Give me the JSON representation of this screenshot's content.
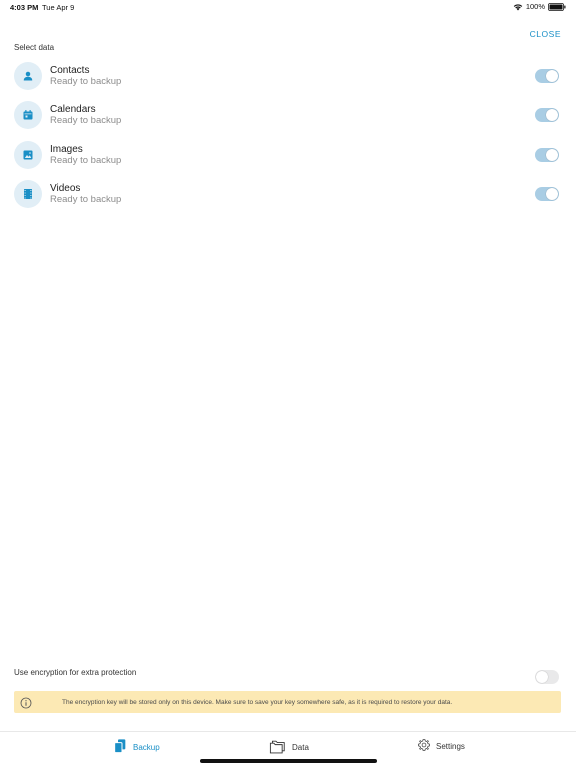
{
  "status_bar": {
    "time": "4:03 PM",
    "date": "Tue Apr 9",
    "battery": "100%",
    "icons": [
      "wifi-icon",
      "battery-icon"
    ]
  },
  "header": {
    "close_label": "CLOSE"
  },
  "select_data": {
    "title": "Select data",
    "items": [
      {
        "label": "Contacts",
        "status": "Ready to backup",
        "icon": "contacts-icon",
        "enabled": true
      },
      {
        "label": "Calendars",
        "status": "Ready to backup",
        "icon": "calendar-icon",
        "enabled": true
      },
      {
        "label": "Images",
        "status": "Ready to backup",
        "icon": "image-icon",
        "enabled": true
      },
      {
        "label": "Videos",
        "status": "Ready to backup",
        "icon": "video-icon",
        "enabled": true
      }
    ]
  },
  "encryption": {
    "label": "Use encryption for extra protection",
    "enabled": false,
    "info": "The encryption key will be stored only on this device. Make sure to save your key somewhere safe, as it is required to restore your data."
  },
  "tabs": [
    {
      "label": "Backup",
      "icon": "backup-icon",
      "active": true
    },
    {
      "label": "Data",
      "icon": "folder-icon",
      "active": false
    },
    {
      "label": "Settings",
      "icon": "gear-icon",
      "active": false
    }
  ],
  "colors": {
    "accent": "#1a8fc6",
    "icon_circle": "#e1eef6",
    "toggle_on": "#a9cde4",
    "toggle_off": "#e9e9ea",
    "info_bg": "#fce9b4"
  }
}
